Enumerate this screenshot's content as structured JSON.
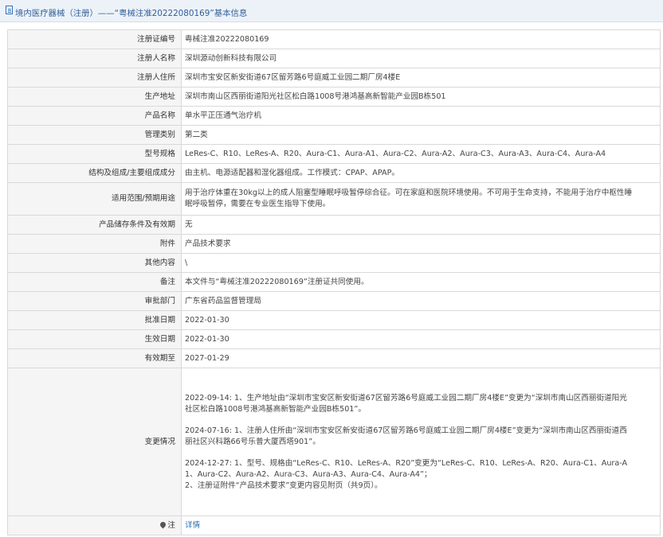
{
  "header": {
    "title": "境内医疗器械（注册）——“粤械注准20222080169”基本信息"
  },
  "rows": [
    {
      "label": "注册证编号",
      "value": "粤械注准20222080169"
    },
    {
      "label": "注册人名称",
      "value": "深圳源动创新科技有限公司"
    },
    {
      "label": "注册人住所",
      "value": "深圳市宝安区新安街道67区留芳路6号庭威工业园二期厂房4楼E"
    },
    {
      "label": "生产地址",
      "value": "深圳市南山区西丽街道阳光社区松白路1008号港鸿基高新智能产业园B栋501"
    },
    {
      "label": "产品名称",
      "value": "单水平正压通气治疗机"
    },
    {
      "label": "管理类别",
      "value": "第二类"
    },
    {
      "label": "型号规格",
      "value": "LeRes-C、R10、LeRes-A、R20、Aura-C1、Aura-A1、Aura-C2、Aura-A2、Aura-C3、Aura-A3、Aura-C4、Aura-A4"
    },
    {
      "label": "结构及组成/主要组成成分",
      "value": "由主机、电源适配器和湿化器组成。工作模式：CPAP、APAP。"
    },
    {
      "label": "适用范围/预期用途",
      "value_lines": [
        "用于治疗体重在30kg以上的成人阻塞型睡眠呼吸暂停综合征。可在家庭和医院环境使用。不可用于生命支持，不能用于治疗中枢性睡",
        "眠呼吸暂停，需要在专业医生指导下使用。"
      ]
    },
    {
      "label": "产品储存条件及有效期",
      "value": "无"
    },
    {
      "label": "附件",
      "value": "产品技术要求"
    },
    {
      "label": "其他内容",
      "value": "\\"
    },
    {
      "label": "备注",
      "value": "本文件与“粤械注准20222080169”注册证共同使用。"
    },
    {
      "label": "审批部门",
      "value": "广东省药品监督管理局"
    },
    {
      "label": "批准日期",
      "value": "2022-01-30"
    },
    {
      "label": "生效日期",
      "value": "2022-01-30"
    },
    {
      "label": "有效期至",
      "value": "2027-01-29"
    }
  ],
  "changes": {
    "label": "变更情况",
    "entries": [
      {
        "lines": [
          "2022-09-14: 1、生产地址由“深圳市宝安区新安街道67区留芳路6号庭威工业园二期厂房4楼E”变更为“深圳市南山区西丽街道阳光",
          "社区松白路1008号港鸿基高新智能产业园B栋501”。"
        ]
      },
      {
        "lines": [
          "2024-07-16: 1、注册人住所由“深圳市宝安区新安街道67区留芳路6号庭威工业园二期厂房4楼E”变更为“深圳市南山区西丽街道西",
          "丽社区兴科路66号乐普大厦西塔901”。"
        ]
      },
      {
        "lines": [
          "2024-12-27: 1、型号、规格由“LeRes-C、R10、LeRes-A、R20”变更为“LeRes-C、R10、LeRes-A、R20、Aura-C1、Aura-A",
          "1、Aura-C2、Aura-A2、Aura-C3、Aura-A3、Aura-C4、Aura-A4”；",
          "2、注册证附件“产品技术要求”变更内容见附页（共9页）。"
        ]
      }
    ]
  },
  "footer_row": {
    "label": "注",
    "link_text": "详情",
    "icon": "map-pin-icon"
  }
}
